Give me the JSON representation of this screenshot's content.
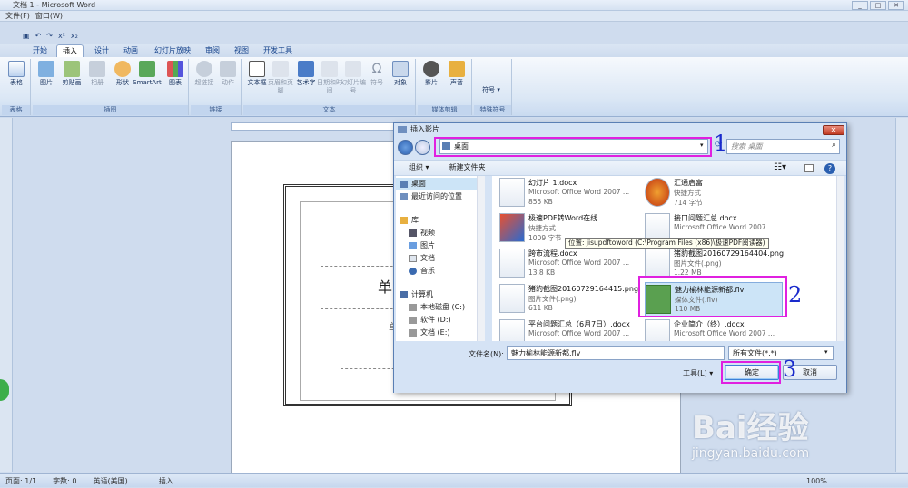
{
  "app": {
    "window_title": "文档 1 - Microsoft Word",
    "menu": [
      "文件(F)",
      "窗口(W)"
    ],
    "tabs": [
      "开始",
      "插入",
      "设计",
      "动画",
      "幻灯片放映",
      "审阅",
      "视图",
      "开发工具"
    ],
    "active_tab": "插入",
    "ribbon_groups": [
      {
        "label": "表格",
        "buttons": [
          "表格"
        ]
      },
      {
        "label": "插图",
        "buttons": [
          "图片",
          "剪贴画",
          "相册",
          "形状",
          "SmartArt",
          "图表"
        ]
      },
      {
        "label": "链接",
        "buttons": [
          "超链接",
          "动作"
        ]
      },
      {
        "label": "文本",
        "buttons": [
          "文本框",
          "页眉和页脚",
          "艺术字",
          "日期和时间",
          "幻灯片编号",
          "符号",
          "对象"
        ]
      },
      {
        "label": "媒体剪辑",
        "buttons": [
          "影片",
          "声音"
        ]
      },
      {
        "label": "特殊符号",
        "buttons": [
          "符号"
        ]
      }
    ],
    "slide_title_placeholder": "单击",
    "slide_sub_placeholder": "单",
    "status": {
      "page": "页面: 1/1",
      "words": "字数: 0",
      "language": "英语(美国)",
      "mode": "插入",
      "zoom": "100%"
    }
  },
  "dialog": {
    "title": "插入影片",
    "close": "✕",
    "address": "桌面",
    "search_placeholder": "搜索 桌面",
    "toolbar": {
      "organize": "组织 ▾",
      "new_folder": "新建文件夹"
    },
    "nav_items": [
      {
        "label": "桌面",
        "icon": "desktop-icon"
      },
      {
        "label": "最近访问的位置",
        "icon": "recent-icon"
      },
      {
        "label": "库",
        "icon": "library-icon"
      },
      {
        "label": "视频",
        "icon": "video-icon"
      },
      {
        "label": "图片",
        "icon": "picture-icon"
      },
      {
        "label": "文档",
        "icon": "document-icon"
      },
      {
        "label": "音乐",
        "icon": "music-icon"
      },
      {
        "label": "计算机",
        "icon": "computer-icon"
      },
      {
        "label": "本地磁盘 (C:)",
        "icon": "disk-icon"
      },
      {
        "label": "软件 (D:)",
        "icon": "disk-icon"
      },
      {
        "label": "文档 (E:)",
        "icon": "disk-icon"
      }
    ],
    "files": [
      {
        "name": "幻灯片 1.docx",
        "type": "Microsoft Office Word 2007 ...",
        "size": "855 KB",
        "icon": "word-doc-icon"
      },
      {
        "name": "汇通启富",
        "type": "快捷方式",
        "size": "714 字节",
        "icon": "shortcut-icon"
      },
      {
        "name": "极速PDF转Word在线",
        "type": "快捷方式",
        "size": "1009 字节",
        "icon": "pdf-shortcut-icon"
      },
      {
        "name": "接口问题汇总.docx",
        "type": "Microsoft Office Word 2007 ...",
        "size": "",
        "icon": "word-doc-icon"
      },
      {
        "name": "跨市流程.docx",
        "type": "Microsoft Office Word 2007 ...",
        "size": "13.8 KB",
        "icon": "word-doc-icon"
      },
      {
        "name": "猪豹截图20160729164404.png",
        "type": "图片文件(.png)",
        "size": "1.22 MB",
        "icon": "image-file-icon"
      },
      {
        "name": "猪豹截图20160729164415.png",
        "type": "图片文件(.png)",
        "size": "611 KB",
        "icon": "image-file-icon"
      },
      {
        "name": "魅力榆林能源新都.flv",
        "type": "媒体文件(.flv)",
        "size": "110 MB",
        "icon": "flv-file-icon"
      },
      {
        "name": "平台问题汇总（6月7日）.docx",
        "type": "Microsoft Office Word 2007 ...",
        "size": "",
        "icon": "word-doc-icon"
      },
      {
        "name": "企业简介（终）.docx",
        "type": "Microsoft Office Word 2007 ...",
        "size": "",
        "icon": "word-doc-icon"
      }
    ],
    "tooltip": "位置: jisupdftoword (C:\\Program Files (x86)\\极速PDF阅读器)",
    "filename_label": "文件名(N):",
    "filename_value": "魅力榆林能源新都.flv",
    "filetype_value": "所有文件(*.*)",
    "tools_label": "工具(L)",
    "ok_label": "确定",
    "cancel_label": "取消"
  },
  "annotations": {
    "step1": "1",
    "step2": "2",
    "step3": "3"
  },
  "watermark": {
    "brand": "Bai经验",
    "url": "jingyan.baidu.com"
  }
}
